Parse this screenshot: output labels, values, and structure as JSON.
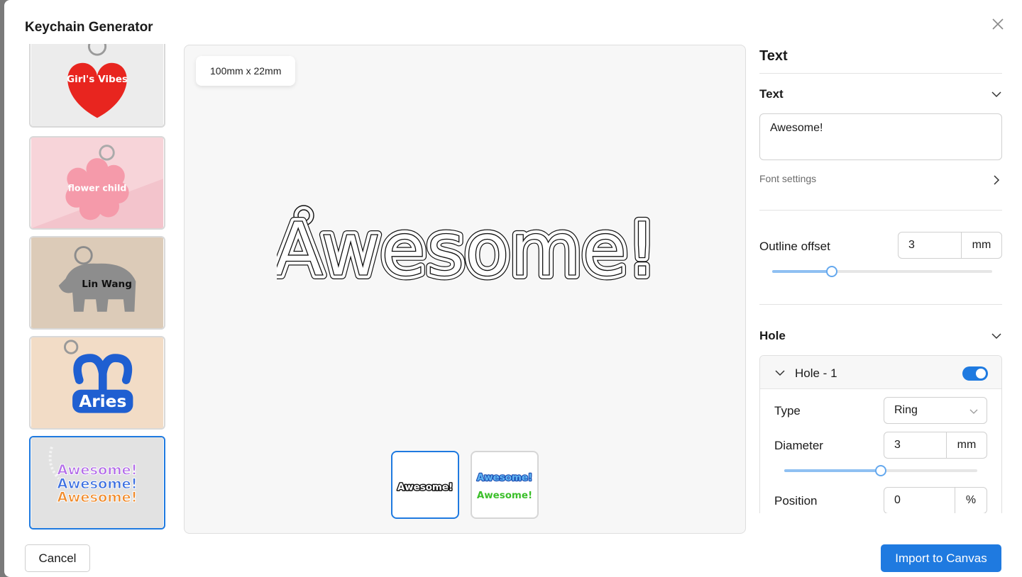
{
  "dialog": {
    "title": "Keychain Generator",
    "close_icon": "close-icon"
  },
  "templates": [
    {
      "name": "heart-keychain",
      "text": "Girl's Vibes",
      "selected": false
    },
    {
      "name": "flower-keychain",
      "text": "flower child",
      "selected": false
    },
    {
      "name": "elephant-keychain",
      "text": "Lin Wang",
      "selected": false
    },
    {
      "name": "aries-keychain",
      "text": "Aries",
      "selected": false
    },
    {
      "name": "awesome-keychain",
      "text": "Awesome!",
      "selected": true
    }
  ],
  "preview": {
    "dimensions": "100mm x 22mm",
    "outline_text": "Awesome!",
    "variants": [
      {
        "name": "outline-variant",
        "text": "Awesome!",
        "selected": true
      },
      {
        "name": "color-variant",
        "text": "Awesome!",
        "selected": false
      }
    ]
  },
  "panel": {
    "heading": "Text",
    "text_section": {
      "title": "Text",
      "value": "Awesome!",
      "font_settings": "Font settings"
    },
    "outline": {
      "label": "Outline offset",
      "value": "3",
      "unit": "mm",
      "slider_fraction": 0.26
    },
    "hole_section": {
      "title": "Hole",
      "hole": {
        "label": "Hole - 1",
        "enabled": true,
        "type_label": "Type",
        "type_value": "Ring",
        "diameter_label": "Diameter",
        "diameter_value": "3",
        "diameter_unit": "mm",
        "diameter_slider_fraction": 0.5,
        "position_label": "Position",
        "position_value": "0",
        "position_unit": "%"
      }
    }
  },
  "footer": {
    "cancel_label": "Cancel",
    "import_label": "Import to Canvas"
  },
  "colors": {
    "accent": "#1f7ae0",
    "selected_border": "#1f7ae0"
  }
}
